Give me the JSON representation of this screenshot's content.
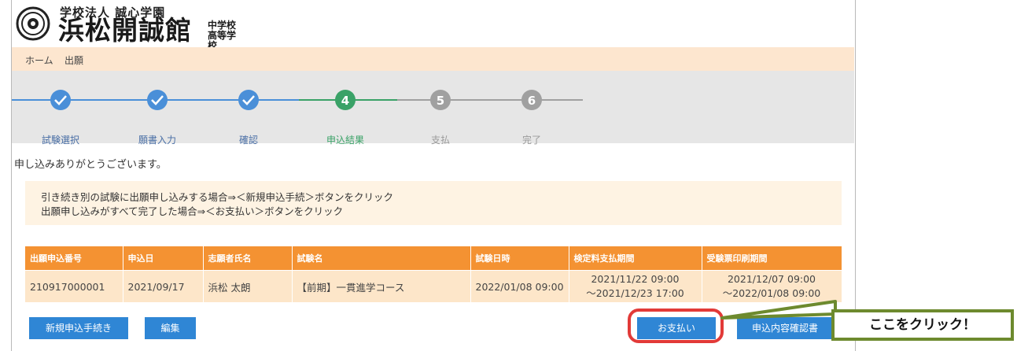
{
  "header": {
    "org_name": "学校法人 誠心学園",
    "school_name": "浜松開誠館",
    "school_levels": "中学校 高等学校"
  },
  "breadcrumb": {
    "home": "ホーム",
    "current": "出願"
  },
  "steps": [
    {
      "number": "1",
      "label": "試験選択",
      "state": "done"
    },
    {
      "number": "2",
      "label": "願書入力",
      "state": "done"
    },
    {
      "number": "3",
      "label": "確認",
      "state": "done"
    },
    {
      "number": "4",
      "label": "申込結果",
      "state": "current"
    },
    {
      "number": "5",
      "label": "支払",
      "state": "pending"
    },
    {
      "number": "6",
      "label": "完了",
      "state": "pending"
    }
  ],
  "thanks_message": "申し込みありがとうございます。",
  "notice": {
    "line1": "引き続き別の試験に出願申し込みする場合⇒＜新規申込手続＞ボタンをクリック",
    "line2": "出願申し込みがすべて完了した場合⇒＜お支払い＞ボタンをクリック"
  },
  "table": {
    "headers": [
      "出願申込番号",
      "申込日",
      "志願者氏名",
      "試験名",
      "試験日時",
      "検定料支払期間",
      "受験票印刷期間"
    ],
    "rows": [
      {
        "app_no": "210917000001",
        "date": "2021/09/17",
        "name": "浜松 太朗",
        "exam": "【前期】一貫進学コース",
        "exam_datetime": "2022/01/08 09:00",
        "fee_from": "2021/11/22 09:00",
        "fee_to": "～2021/12/23 17:00",
        "print_from": "2021/12/07 09:00",
        "print_to": "～2022/01/08 09:00"
      }
    ]
  },
  "buttons": {
    "new_application": "新規申込手続き",
    "edit": "編集",
    "pay": "お支払い",
    "confirm_doc": "申込内容確認書"
  },
  "callout": "ここをクリック！",
  "colors": {
    "accent_orange": "#f49232",
    "button_blue": "#2f86d5",
    "step_done_blue": "#4a8fd8",
    "step_current_green": "#3aa267",
    "step_pending_gray": "#a0a0a0",
    "highlight_red": "#e23a38",
    "callout_green": "#6d8a2e"
  }
}
